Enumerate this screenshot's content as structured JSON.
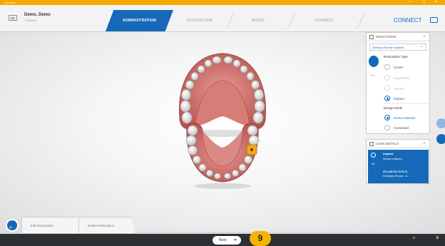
{
  "window": {
    "title": "Connect",
    "controls": "— ▢ ✕"
  },
  "patient": {
    "name": "Demo, Demo",
    "id": "* 01/2019"
  },
  "tabs": [
    {
      "label": "ADMINISTRATION",
      "active": true
    },
    {
      "label": "ACQUISITION",
      "active": false
    },
    {
      "label": "MODEL",
      "active": false
    },
    {
      "label": "CONNECT",
      "active": false
    }
  ],
  "connect_brand": "CONNECT",
  "indications": {
    "title": "INDICATIONS",
    "system_value": "Dentsply Sirona Implants",
    "restoration_type_label": "Restoration Type",
    "restoration_options": [
      {
        "label": "Crown",
        "selected": false,
        "enabled": true
      },
      {
        "label": "Inlay/Onlay",
        "selected": false,
        "enabled": false
      },
      {
        "label": "Veneer",
        "selected": false,
        "enabled": false
      },
      {
        "label": "Implant",
        "selected": true,
        "enabled": true
      }
    ],
    "design_mode_label": "Design Mode",
    "design_options": [
      {
        "label": "Screw retained",
        "selected": true
      },
      {
        "label": "Cemented",
        "selected": false
      }
    ],
    "side_tab_label": "ABC"
  },
  "case_details": {
    "title": "CASE DETAILS",
    "line1": "Implant",
    "line2": "Screw retained",
    "tooth_number": "36",
    "product_line1": "ATLANTIS IO-FLO",
    "product_line2": "Dentsply Sirona - A..."
  },
  "bottom_tabs": {
    "edit": "Edit Restoration",
    "delete": "Delete Restoration"
  },
  "tool_number": "36",
  "footer": {
    "next_label": "Next",
    "step_number": "9",
    "right_symbol": "5"
  },
  "colors": {
    "accent": "#1569b8",
    "titlebar": "#f5a800",
    "highlight": "#f5b400",
    "footer": "#2c2f33"
  }
}
